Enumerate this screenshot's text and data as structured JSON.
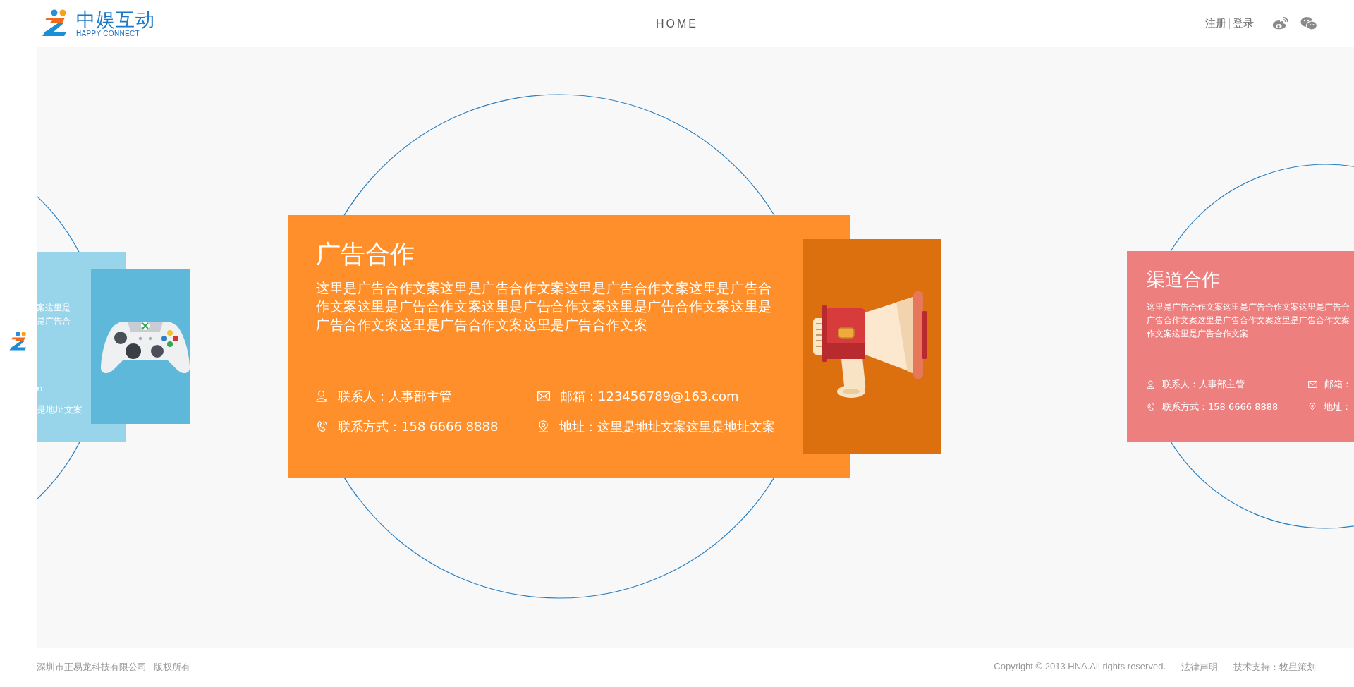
{
  "header": {
    "brand_name": "中娱互动",
    "brand_tagline": "HAPPY CONNECT",
    "nav": [
      {
        "label": "HOME"
      }
    ],
    "auth": [
      "注册",
      "登录"
    ]
  },
  "cards": [
    {
      "kind": "side_left",
      "color": "#98d4ea",
      "fragments": [
        "案这里是",
        "是广告合",
        "n",
        "是地址文案"
      ],
      "illustration": {
        "kind": "gamepad",
        "color": "#5db8d9"
      }
    },
    {
      "kind": "main",
      "color": "#fe8f2a",
      "title": "广告合作",
      "description": "这里是广告合作文案这里是广告合作文案这里是广告合作文案这里是广告合作文案这里是广告合作文案这里是广告合作文案这里是广告合作文案这里是广告合作文案这里是广告合作文案这里是广告合作文案",
      "contacts": [
        {
          "kind": "person",
          "text": "联系人：人事部主管"
        },
        {
          "kind": "email",
          "text": "邮箱：123456789@163.com"
        },
        {
          "kind": "phone",
          "text": "联系方式：158 6666 8888"
        },
        {
          "kind": "address",
          "text": "地址：这里是地址文案这里是地址文案"
        }
      ],
      "illustration": {
        "kind": "megaphone",
        "color": "#dc6f0e"
      }
    },
    {
      "kind": "side_right",
      "color": "#ee7f7f",
      "title": "渠道合作",
      "description_lines": [
        "这里是广告合作文案这里是广告合作文案这里是广告合",
        "广告合作文案这里是广告合作文案这里是广告合作文案",
        "作文案这里是广告合作文案"
      ],
      "contacts": [
        {
          "kind": "person",
          "text": "联系人：人事部主管"
        },
        {
          "kind": "email",
          "text": "邮箱："
        },
        {
          "kind": "phone",
          "text": "联系方式：158 6666 8888"
        },
        {
          "kind": "address",
          "text": "地址："
        }
      ]
    }
  ],
  "footer": {
    "company": "深圳市正易龙科技有限公司",
    "rights": "版权所有",
    "copyright": "Copyright © 2013 HNA.All rights reserved.",
    "legal": "法律声明",
    "support": "技术支持：牧星策划"
  }
}
